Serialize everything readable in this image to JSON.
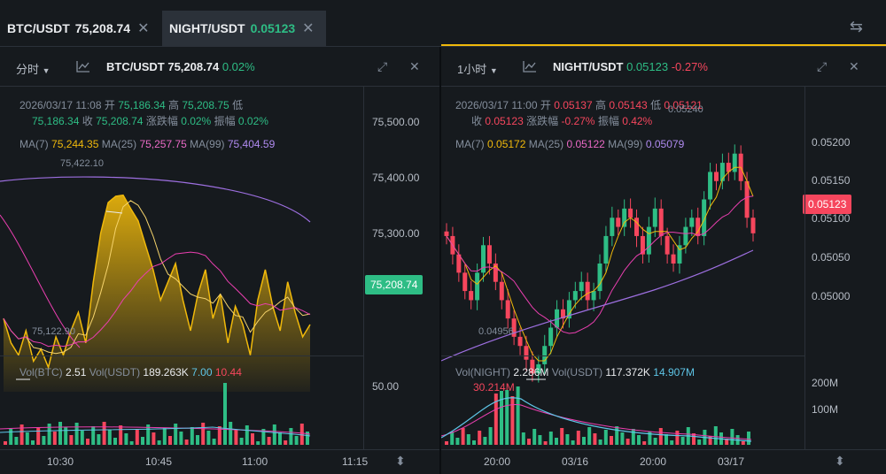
{
  "tabs": [
    {
      "symbol": "BTC/USDT",
      "price": "75,208.74",
      "close": "✕",
      "color": "#eaecef"
    },
    {
      "symbol": "NIGHT/USDT",
      "price": "0.05123",
      "close": "✕",
      "color": "#2ebd85"
    }
  ],
  "left": {
    "interval": "分时",
    "pair": "BTC/USDT",
    "price": "75,208.74",
    "change": "0.02%",
    "info1": {
      "date": "2026/03/17 11:08",
      "open_l": "开",
      "open": "75,186.34",
      "high_l": "高",
      "high": "75,208.75",
      "low_l": "低"
    },
    "info2": {
      "low": "75,186.34",
      "close_l": "收",
      "close": "75,208.74",
      "chg_l": "涨跌幅",
      "chg": "0.02%",
      "amp_l": "振幅",
      "amp": "0.02%"
    },
    "ma": {
      "ma7_l": "MA(7)",
      "ma7": "75,244.35",
      "ma25_l": "MA(25)",
      "ma25": "75,257.75",
      "ma99_l": "MA(99)",
      "ma99": "75,404.59"
    },
    "yaxis": [
      "75,500.00",
      "75,400.00",
      "75,300.00"
    ],
    "last_tag": "75,208.74",
    "hi_label": "75,422.10",
    "lo_label": "75,122.90",
    "vol": {
      "vol_l": "Vol(BTC)",
      "vol": "2.51",
      "volu_l": "Vol(USDT)",
      "volu": "189.263K",
      "a": "7.00",
      "b": "10.44"
    },
    "vol_axis": "50.00",
    "xaxis": [
      "10:30",
      "10:45",
      "11:00",
      "11:15"
    ],
    "chart_data": {
      "type": "area",
      "title": "BTC/USDT",
      "xlabels": [
        "10:30",
        "10:45",
        "11:00",
        "11:15"
      ],
      "ylim": [
        75100,
        75520
      ],
      "values": [
        75220,
        75180,
        75160,
        75200,
        75150,
        75170,
        75140,
        75190,
        75160,
        75200,
        75230,
        75180,
        75280,
        75360,
        75410,
        75420,
        75422,
        75400,
        75380,
        75340,
        75300,
        75250,
        75280,
        75310,
        75250,
        75200,
        75260,
        75300,
        75220,
        75260,
        75180,
        75240,
        75210,
        75160,
        75250,
        75300,
        75240,
        75200,
        75280,
        75230,
        75190,
        75210
      ]
    }
  },
  "right": {
    "interval": "1小时",
    "pair": "NIGHT/USDT",
    "price": "0.05123",
    "change": "-0.27%",
    "info1": {
      "date": "2026/03/17 11:00",
      "open_l": "开",
      "open": "0.05137",
      "high_l": "高",
      "high": "0.05143",
      "low_l": "低",
      "low": "0.05121"
    },
    "info2": {
      "close_l": "收",
      "close": "0.05123",
      "chg_l": "涨跌幅",
      "chg": "-0.27%",
      "amp_l": "振幅",
      "amp": "0.42%"
    },
    "ma": {
      "ma7_l": "MA(7)",
      "ma7": "0.05172",
      "ma25_l": "MA(25)",
      "ma25": "0.05122",
      "ma99_l": "MA(99)",
      "ma99": "0.05079"
    },
    "yaxis": [
      "0.05200",
      "0.05150",
      "0.05100",
      "0.05050",
      "0.05000"
    ],
    "last_tag": "0.05123",
    "hi_label": "0.05240",
    "lo_label": "0.04956",
    "vol": {
      "vol_l": "Vol(NIGHT)",
      "vol": "2.286M",
      "volu_l": "Vol(USDT)",
      "volu": "117.372K",
      "a": "14.907M",
      "b": "30.214M"
    },
    "vol_axis": [
      "200M",
      "100M"
    ],
    "xaxis": [
      "20:00",
      "03/16",
      "20:00",
      "03/17"
    ],
    "chart_data": {
      "type": "candlestick",
      "title": "NIGHT/USDT",
      "xlabels": [
        "20:00",
        "03/16",
        "20:00",
        "03/17"
      ],
      "ylim": [
        0.0495,
        0.0523
      ]
    }
  },
  "icons": {
    "swap": "⇆",
    "chart": "chart-icon",
    "expand": "⤢",
    "close": "✕",
    "dropdown": "▼",
    "fullscreen": "⬍"
  }
}
